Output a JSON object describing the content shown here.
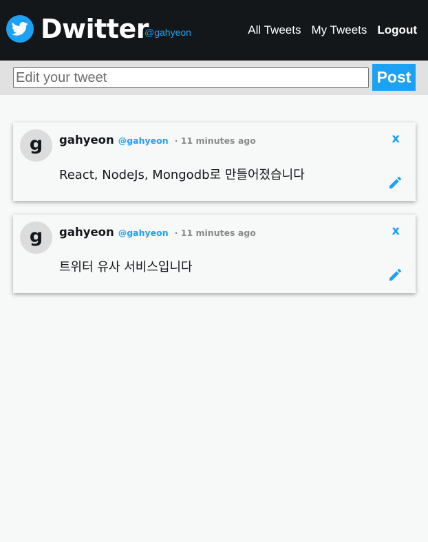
{
  "header": {
    "logo_icon": "twitter-bird-icon",
    "brand": "Dwitter",
    "handle": "@gahyeon",
    "nav": {
      "all_tweets": "All Tweets",
      "my_tweets": "My Tweets",
      "logout": "Logout"
    }
  },
  "composer": {
    "placeholder": "Edit your tweet",
    "value": "",
    "post_label": "Post"
  },
  "tweets": [
    {
      "avatar_letter": "g",
      "name": "gahyeon",
      "handle": "@gahyeon",
      "time": "· 11 minutes ago",
      "text": "React, NodeJs, Mongodb로 만들어졌습니다",
      "delete_label": "x",
      "edit_icon": "pencil-icon"
    },
    {
      "avatar_letter": "g",
      "name": "gahyeon",
      "handle": "@gahyeon",
      "time": "· 11 minutes ago",
      "text": "트위터 유사 서비스입니다",
      "delete_label": "x",
      "edit_icon": "pencil-icon"
    }
  ],
  "colors": {
    "header_bg": "#14171a",
    "accent": "#1da1f2",
    "page_bg": "#f7f9f9",
    "composer_bg": "#e1e1e1"
  }
}
